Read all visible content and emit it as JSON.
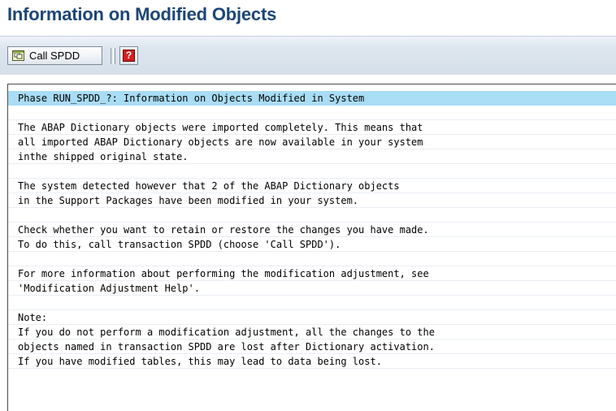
{
  "header": {
    "title": "Information on Modified Objects"
  },
  "toolbar": {
    "call_spdd_label": "Call SPDD",
    "call_spdd_icon": "execute-icon",
    "help_icon": "help-icon",
    "help_glyph": "?"
  },
  "content": {
    "lines": [
      "Phase RUN_SPDD_?: Information on Objects Modified in System",
      "",
      "The ABAP Dictionary objects were imported completely. This means that",
      "all imported ABAP Dictionary objects are now available in your system",
      "inthe shipped original state.",
      "",
      "The system detected however that 2 of the ABAP Dictionary objects",
      "in the Support Packages have been modified in your system.",
      "",
      "Check whether you want to retain or restore the changes you have made.",
      "To do this, call transaction SPDD (choose 'Call SPDD').",
      "",
      "For more information about performing the modification adjustment, see",
      "'Modification Adjustment Help'.",
      "",
      "Note:",
      "If you do not perform a modification adjustment, all the changes to the",
      "objects named in transaction SPDD are lost after Dictionary activation.",
      "If you have modified tables, this may lead to data being lost."
    ]
  },
  "colors": {
    "title": "#1c4677",
    "highlight_row": "#a9dcf5",
    "toolbar_bg": "#d5dfe9"
  }
}
